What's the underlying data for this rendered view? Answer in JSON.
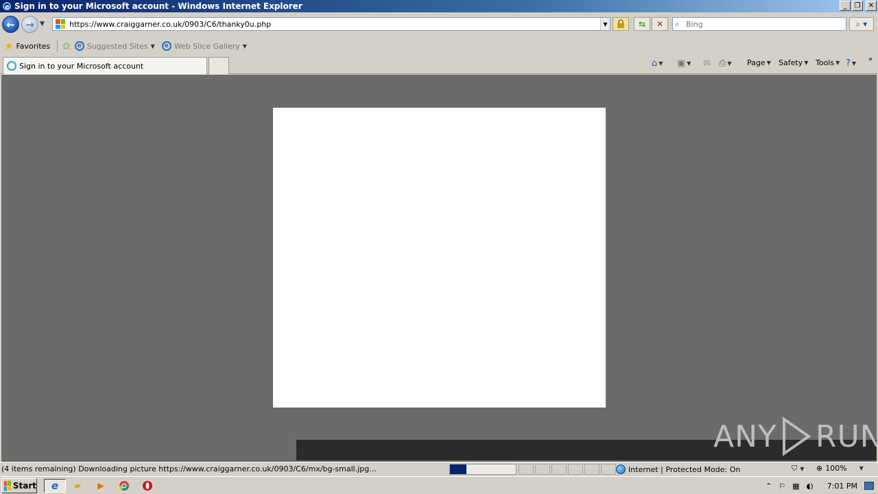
{
  "window": {
    "title": "Sign in to your Microsoft account - Windows Internet Explorer",
    "buttons": {
      "minimize": "_",
      "restore": "❐",
      "close": "✕"
    }
  },
  "address": {
    "url": "https://www.craiggarner.co.uk/0903/C6/thanky0u.php",
    "search_placeholder": "Bing"
  },
  "favorites": {
    "label": "Favorites",
    "items": [
      "Suggested Sites",
      "Web Slice Gallery"
    ]
  },
  "tab": {
    "title": "Sign in to your Microsoft account"
  },
  "commands": {
    "page": "Page",
    "safety": "Safety",
    "tools": "Tools"
  },
  "status": {
    "text": "(4 items remaining) Downloading picture https://www.craiggarner.co.uk/0903/C6/mx/bg-small.jpg...",
    "progress": 0.25,
    "zone": "Internet | Protected Mode: On",
    "zoom": "100%"
  },
  "watermark": {
    "left": "ANY",
    "right": "RUN"
  },
  "taskbar": {
    "start": "Start",
    "clock": "7:01 PM"
  },
  "colors": {
    "accent": "#0a246a",
    "content_bg": "#6b6b6b"
  }
}
